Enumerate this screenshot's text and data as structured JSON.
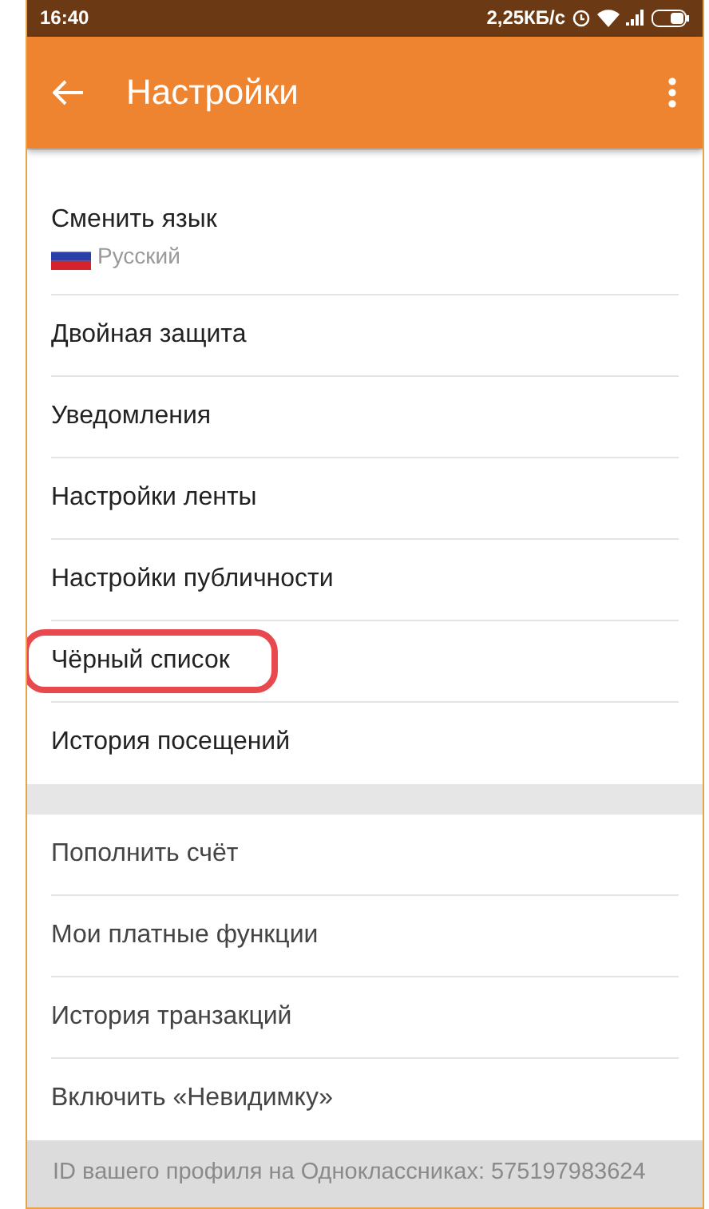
{
  "status_bar": {
    "time": "16:40",
    "speed": "2,25КБ/с"
  },
  "app_bar": {
    "title": "Настройки"
  },
  "sections": [
    {
      "items": [
        {
          "label": "Сменить язык",
          "sublabel": "Русский",
          "highlighted": false
        },
        {
          "label": "Двойная защита",
          "highlighted": false
        },
        {
          "label": "Уведомления",
          "highlighted": false
        },
        {
          "label": "Настройки ленты",
          "highlighted": false
        },
        {
          "label": "Настройки публичности",
          "highlighted": false
        },
        {
          "label": "Чёрный список",
          "highlighted": true
        },
        {
          "label": "История посещений",
          "highlighted": false
        }
      ]
    },
    {
      "items": [
        {
          "label": "Пополнить счёт",
          "highlighted": false
        },
        {
          "label": "Мои платные функции",
          "highlighted": false
        },
        {
          "label": "История транзакций",
          "highlighted": false
        },
        {
          "label": "Включить «Невидимку»",
          "highlighted": false
        }
      ]
    }
  ],
  "footer": "ID вашего профиля на Одноклассниках: 575197983624"
}
